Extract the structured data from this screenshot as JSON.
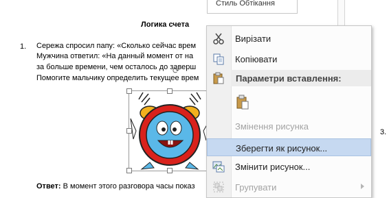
{
  "document": {
    "title": "Логика счета",
    "item_number": "1.",
    "lines": [
      "Сережа спросил папу: «Сколько сейчас врем",
      "Мужчина ответил: «На данный момент от на",
      "за больше времени, чем осталось до заверш",
      "Помогите мальчику определить текущее врем"
    ],
    "answer_label": "Ответ:",
    "answer_text": " В момент этого разговора часы показ",
    "right_number": "3."
  },
  "style_popup": {
    "label": "Стиль  Обтікання"
  },
  "context_menu": {
    "items": [
      {
        "label": "Вирізати",
        "icon": "scissors-icon",
        "enabled": true
      },
      {
        "label": "Копіювати",
        "icon": "copy-icon",
        "enabled": true
      },
      {
        "label": "Параметри вставлення:",
        "icon": "paste-icon",
        "enabled": true
      },
      {
        "label": "",
        "icon": "paste-option-icon",
        "enabled": true
      },
      {
        "label": "Змінення рисунка",
        "icon": "",
        "enabled": false
      },
      {
        "label": "Зберегти як рисунок...",
        "icon": "",
        "enabled": true
      },
      {
        "label": "Змінити рисунок...",
        "icon": "change-picture-icon",
        "enabled": true
      },
      {
        "label": "Групувати",
        "icon": "group-icon",
        "enabled": false
      }
    ]
  },
  "colors": {
    "highlight": "#c6d9f1",
    "clock_red": "#d9221c",
    "clock_face": "#5ab8e8",
    "bell_gold": "#f2b01e"
  }
}
